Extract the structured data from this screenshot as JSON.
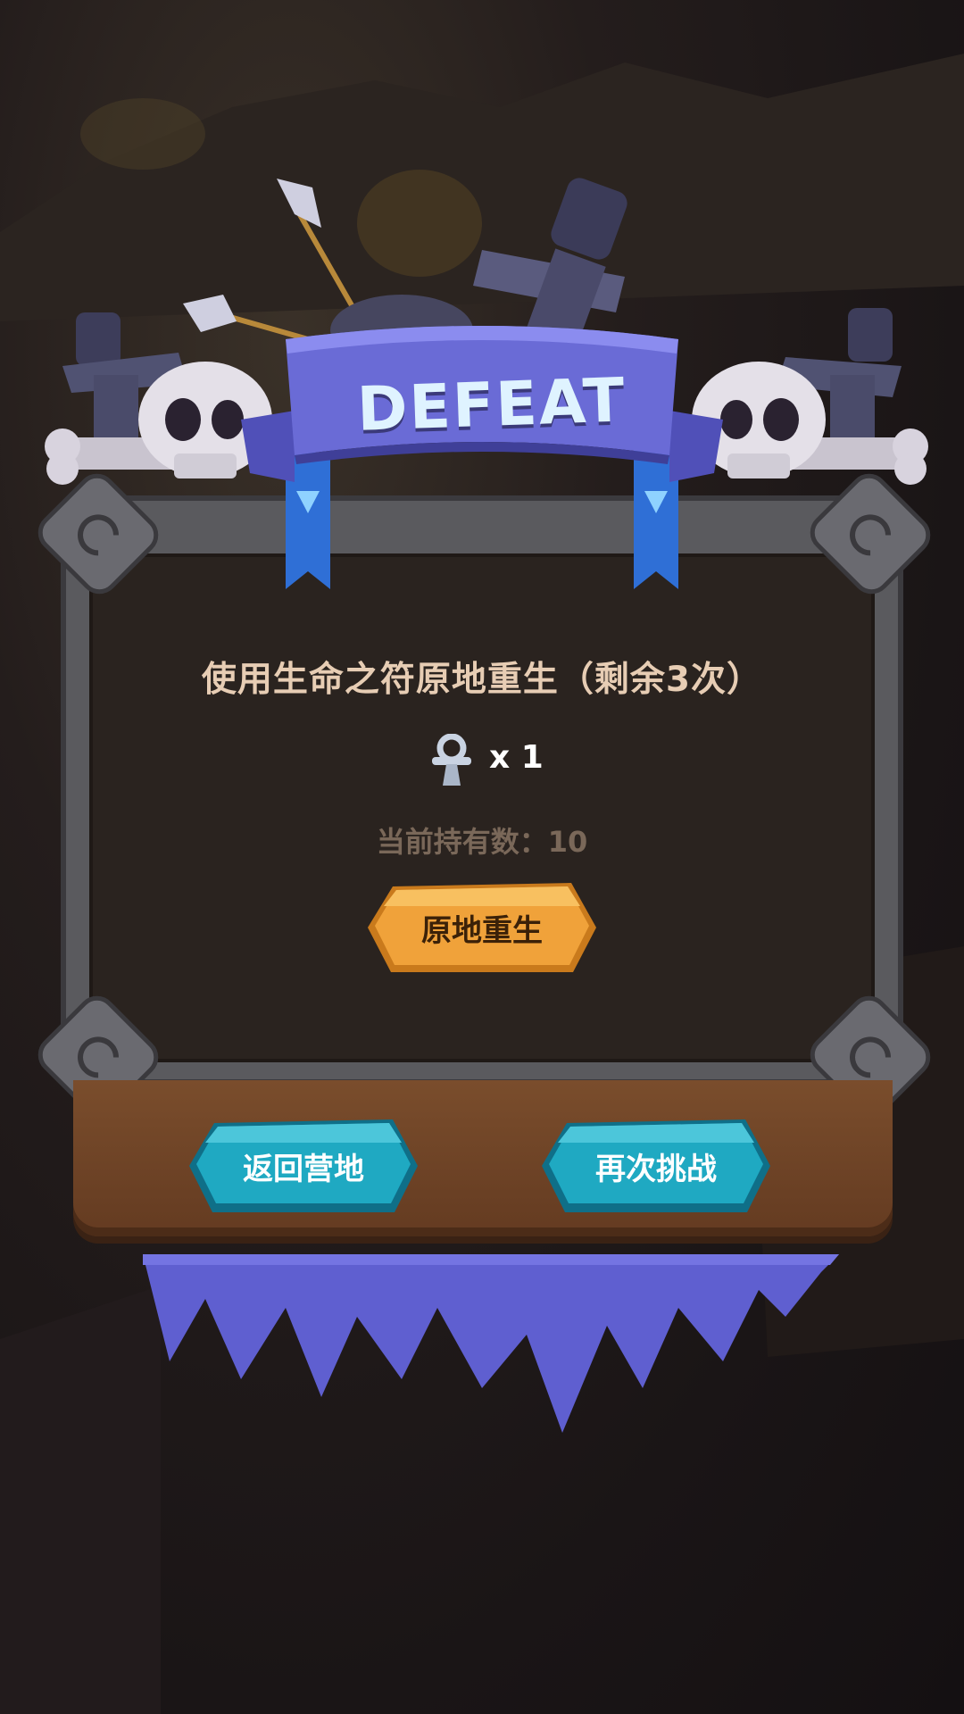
{
  "banner": {
    "title": "DEFEAT"
  },
  "dialog": {
    "message": "使用生命之符原地重生（剩余3次）",
    "item": {
      "icon": "ankh-icon",
      "count_text": "x 1"
    },
    "held_text": "当前持有数：10",
    "revive_button": "原地重生"
  },
  "footer": {
    "return_button": "返回营地",
    "retry_button": "再次挑战"
  },
  "colors": {
    "banner": "#6a6bd6",
    "revive_button": "#f0a23a",
    "blue_button": "#1fa9c2",
    "frame": "#5a5a5e",
    "panel": "#2a231f",
    "wood": "#764a2a",
    "icicles": "#5f5fd0"
  }
}
